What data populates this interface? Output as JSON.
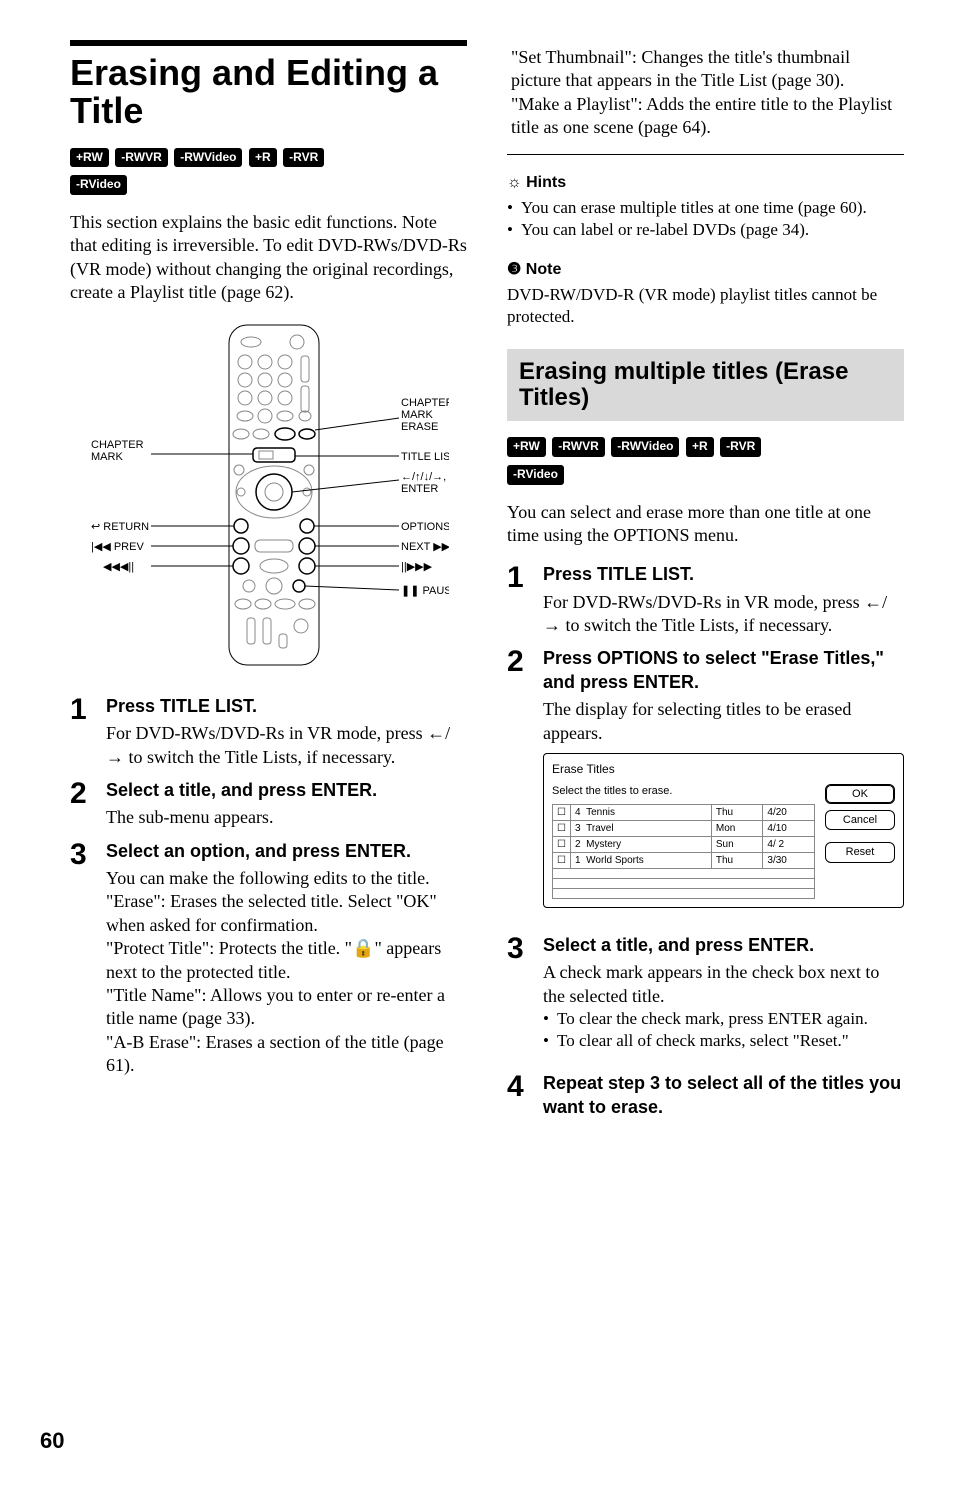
{
  "page_number": "60",
  "main_title": "Erasing and Editing a Title",
  "disc_badges_1": [
    "+RW",
    "-RWVR",
    "-RWVideo",
    "+R",
    "-RVR",
    "-RVideo"
  ],
  "intro_text": "This section explains the basic edit functions. Note that editing is irreversible. To edit DVD-RWs/DVD-Rs (VR mode) without changing the original recordings, create a Playlist title (page 62).",
  "remote_labels": {
    "left": [
      "CHAPTER MARK",
      "↩ RETURN",
      "|◀◀ PREV",
      "◀◀◀||"
    ],
    "right": [
      "CHAPTER MARK ERASE",
      "TITLE LIST",
      "←/↑/↓/→, ENTER",
      "OPTIONS",
      "NEXT ▶▶|",
      "||▶▶▶",
      "❚❚ PAUSE"
    ]
  },
  "steps_left": [
    {
      "num": "1",
      "head": "Press TITLE LIST.",
      "text": "For DVD-RWs/DVD-Rs in VR mode, press ←/→ to switch the Title Lists, if necessary."
    },
    {
      "num": "2",
      "head": "Select a title, and press ENTER.",
      "text": "The sub-menu appears."
    },
    {
      "num": "3",
      "head": "Select an option, and press ENTER.",
      "text": "You can make the following edits to the title.\n\"Erase\": Erases the selected title. Select \"OK\" when asked for confirmation.\n\"Protect Title\": Protects the title. \"🔒\" appears next to the protected title.\n\"Title Name\": Allows you to enter or re-enter a title name (page 33).\n\"A-B Erase\": Erases a section of the title (page 61)."
    }
  ],
  "right_top_text": "\"Set Thumbnail\": Changes the title's thumbnail picture that appears in the Title List (page 30).\n\"Make a Playlist\": Adds the entire title to the Playlist title as one scene (page 64).",
  "hints_label": "Hints",
  "hints": [
    "You can erase multiple titles at one time (page 60).",
    "You can label or re-label DVDs (page 34)."
  ],
  "note_label": "Note",
  "note_text": "DVD-RW/DVD-R (VR mode) playlist titles cannot be protected.",
  "section_title": "Erasing multiple titles (Erase Titles)",
  "disc_badges_2": [
    "+RW",
    "-RWVR",
    "-RWVideo",
    "+R",
    "-RVR",
    "-RVideo"
  ],
  "section_intro": "You can select and erase more than one title at one time using the OPTIONS menu.",
  "steps_right": [
    {
      "num": "1",
      "head": "Press TITLE LIST.",
      "text": "For DVD-RWs/DVD-Rs in VR mode, press ←/→ to switch the Title Lists, if necessary."
    },
    {
      "num": "2",
      "head": "Press OPTIONS to select \"Erase Titles,\" and press ENTER.",
      "text": "The display for selecting titles to be erased appears."
    }
  ],
  "screenshot": {
    "title": "Erase Titles",
    "subtitle": "Select the titles to erase.",
    "buttons": [
      "OK",
      "Cancel",
      "Reset"
    ],
    "rows": [
      {
        "checked": false,
        "idx": "4",
        "name": "Tennis",
        "day": "Thu",
        "date": "4/20"
      },
      {
        "checked": false,
        "idx": "3",
        "name": "Travel",
        "day": "Mon",
        "date": "4/10"
      },
      {
        "checked": false,
        "idx": "2",
        "name": "Mystery",
        "day": "Sun",
        "date": "4/ 2"
      },
      {
        "checked": false,
        "idx": "1",
        "name": "World Sports",
        "day": "Thu",
        "date": "3/30"
      }
    ]
  },
  "steps_right_after": [
    {
      "num": "3",
      "head": "Select a title, and press ENTER.",
      "text": "A check mark appears in the check box next to the selected title.",
      "bullets": [
        "To clear the check mark, press ENTER again.",
        "To clear all of check marks, select \"Reset.\""
      ]
    },
    {
      "num": "4",
      "head": "Repeat step 3 to select all of the titles you want to erase.",
      "text": ""
    }
  ]
}
